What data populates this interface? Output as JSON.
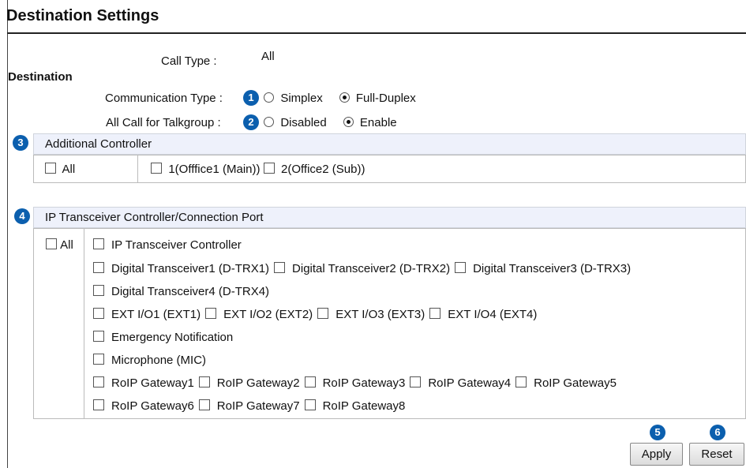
{
  "title": "Destination Settings",
  "call_type": {
    "label": "Call Type :",
    "value": "All"
  },
  "destination_label": "Destination",
  "communication_type": {
    "label": "Communication Type :",
    "badge": "1",
    "options": [
      {
        "label": "Simplex",
        "selected": false
      },
      {
        "label": "Full-Duplex",
        "selected": true
      }
    ]
  },
  "all_call": {
    "label": "All Call for Talkgroup :",
    "badge": "2",
    "options": [
      {
        "label": "Disabled",
        "selected": false
      },
      {
        "label": "Enable",
        "selected": true
      }
    ]
  },
  "additional_controller": {
    "badge": "3",
    "heading": "Additional Controller",
    "all_label": "All",
    "items": [
      "1(Offfice1 (Main))",
      "2(Office2 (Sub))"
    ]
  },
  "ip_transceiver": {
    "badge": "4",
    "heading": "IP Transceiver Controller/Connection Port",
    "all_label": "All",
    "rows": [
      [
        "IP Transceiver Controller"
      ],
      [
        "Digital Transceiver1 (D-TRX1)",
        "Digital Transceiver2 (D-TRX2)",
        "Digital Transceiver3 (D-TRX3)"
      ],
      [
        "Digital Transceiver4 (D-TRX4)"
      ],
      [
        "EXT I/O1 (EXT1)",
        "EXT I/O2 (EXT2)",
        "EXT I/O3 (EXT3)",
        "EXT I/O4 (EXT4)"
      ],
      [
        "Emergency Notification"
      ],
      [
        "Microphone (MIC)"
      ],
      [
        "RoIP Gateway1",
        "RoIP Gateway2",
        "RoIP Gateway3",
        "RoIP Gateway4",
        "RoIP Gateway5"
      ],
      [
        "RoIP Gateway6",
        "RoIP Gateway7",
        "RoIP Gateway8"
      ]
    ]
  },
  "buttons": {
    "apply": {
      "label": "Apply",
      "badge": "5"
    },
    "reset": {
      "label": "Reset",
      "badge": "6"
    }
  },
  "colors": {
    "badge": "#0b5fae",
    "section_header_bg": "#eef1fb"
  }
}
